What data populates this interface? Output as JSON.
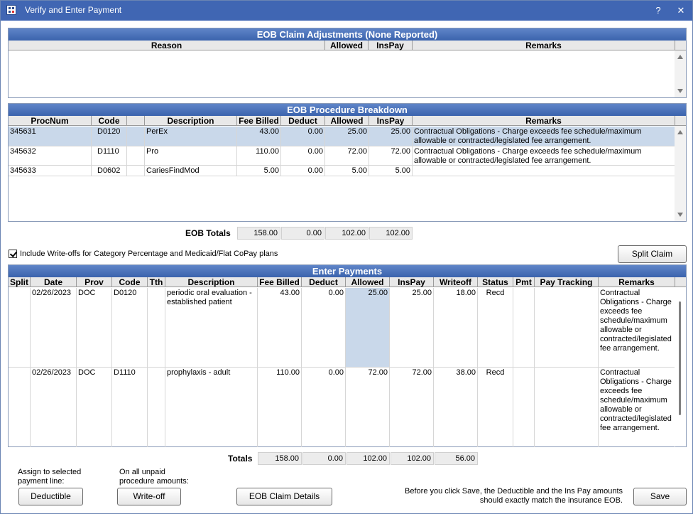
{
  "window": {
    "title": "Verify and Enter Payment",
    "help": "?",
    "close": "✕"
  },
  "claim_adjustments": {
    "header": "EOB Claim Adjustments (None Reported)",
    "columns": [
      "Reason",
      "Allowed",
      "InsPay",
      "Remarks"
    ]
  },
  "procedure_breakdown": {
    "header": "EOB Procedure Breakdown",
    "columns": [
      "ProcNum",
      "Code",
      "",
      "Description",
      "Fee Billed",
      "Deduct",
      "Allowed",
      "InsPay",
      "Remarks"
    ],
    "rows": [
      {
        "procnum": "345631",
        "code": "D0120",
        "mod": "",
        "description": "PerEx",
        "fee": "43.00",
        "deduct": "0.00",
        "allowed": "25.00",
        "inspay": "25.00",
        "remarks": "Contractual Obligations - Charge exceeds fee schedule/maximum allowable or contracted/legislated fee arrangement."
      },
      {
        "procnum": "345632",
        "code": "D1110",
        "mod": "",
        "description": "Pro",
        "fee": "110.00",
        "deduct": "0.00",
        "allowed": "72.00",
        "inspay": "72.00",
        "remarks": "Contractual Obligations - Charge exceeds fee schedule/maximum allowable or contracted/legislated fee arrangement."
      },
      {
        "procnum": "345633",
        "code": "D0602",
        "mod": "",
        "description": "CariesFindMod",
        "fee": "5.00",
        "deduct": "0.00",
        "allowed": "5.00",
        "inspay": "5.00",
        "remarks": ""
      }
    ],
    "totals_label": "EOB Totals",
    "totals": [
      "158.00",
      "0.00",
      "102.00",
      "102.00"
    ]
  },
  "writeoff_checkbox": {
    "label": "Include Write-offs for Category Percentage and Medicaid/Flat CoPay plans",
    "checked": true
  },
  "split_claim_label": "Split Claim",
  "enter_payments": {
    "header": "Enter Payments",
    "columns": [
      "Split",
      "Date",
      "Prov",
      "Code",
      "Tth",
      "Description",
      "Fee Billed",
      "Deduct",
      "Allowed",
      "InsPay",
      "Writeoff",
      "Status",
      "Pmt",
      "Pay Tracking",
      "Remarks"
    ],
    "rows": [
      {
        "split": "",
        "date": "02/26/2023",
        "prov": "DOC",
        "code": "D0120",
        "tth": "",
        "description": "periodic oral evaluation - established patient",
        "fee": "43.00",
        "deduct": "0.00",
        "allowed": "25.00",
        "inspay": "25.00",
        "writeoff": "18.00",
        "status": "Recd",
        "pmt": "",
        "tracking": "",
        "remarks": "Contractual Obligations - Charge exceeds fee schedule/maximum allowable or contracted/legislated fee arrangement."
      },
      {
        "split": "",
        "date": "02/26/2023",
        "prov": "DOC",
        "code": "D1110",
        "tth": "",
        "description": "prophylaxis - adult",
        "fee": "110.00",
        "deduct": "0.00",
        "allowed": "72.00",
        "inspay": "72.00",
        "writeoff": "38.00",
        "status": "Recd",
        "pmt": "",
        "tracking": "",
        "remarks": "Contractual Obligations - Charge exceeds fee schedule/maximum allowable or contracted/legislated fee arrangement."
      }
    ],
    "totals_label": "Totals",
    "totals": [
      "158.00",
      "0.00",
      "102.00",
      "102.00",
      "56.00"
    ]
  },
  "footer": {
    "assign_note": "Assign to selected payment line:",
    "deductible_label": "Deductible",
    "unpaid_note": "On all unpaid procedure amounts:",
    "writeoff_label": "Write-off",
    "eob_details_label": "EOB Claim Details",
    "save_note": "Before you click Save, the Deductible and the Ins Pay amounts should exactly match the insurance EOB.",
    "save_label": "Save"
  }
}
